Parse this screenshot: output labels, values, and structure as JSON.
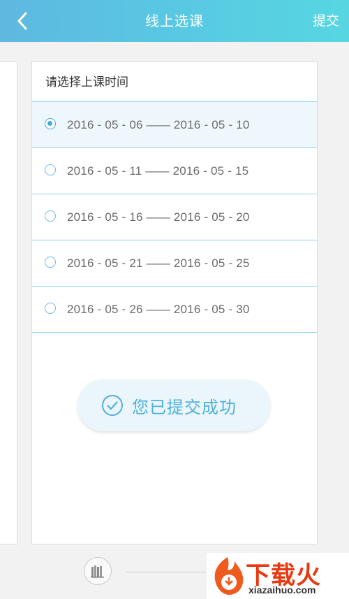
{
  "header": {
    "title": "线上选课",
    "submit_label": "提交",
    "back_icon": "chevron-left-icon"
  },
  "card": {
    "title": "请选择上课时间",
    "options": [
      {
        "label": "2016 - 05 - 06 —— 2016 - 05 - 10",
        "selected": true
      },
      {
        "label": "2016 - 05 - 11 —— 2016 - 05 - 15",
        "selected": false
      },
      {
        "label": "2016 - 05 - 16 —— 2016 - 05 - 20",
        "selected": false
      },
      {
        "label": "2016 - 05 - 21 —— 2016 - 05 - 25",
        "selected": false
      },
      {
        "label": "2016 - 05 - 26 —— 2016 - 05 - 30",
        "selected": false
      }
    ]
  },
  "toast": {
    "text": "您已提交成功",
    "icon": "check-circle-icon"
  },
  "bottom": {
    "icon": "books-icon"
  },
  "watermark": {
    "title": "下载火",
    "domain": "xiazaihuo.com"
  },
  "colors": {
    "header_start": "#5fb8e0",
    "header_end": "#57d6e2",
    "accent": "#4aa8e0",
    "divider": "#8fd3ee",
    "toast_text": "#4fb0dc",
    "watermark_red": "#e9380f"
  }
}
